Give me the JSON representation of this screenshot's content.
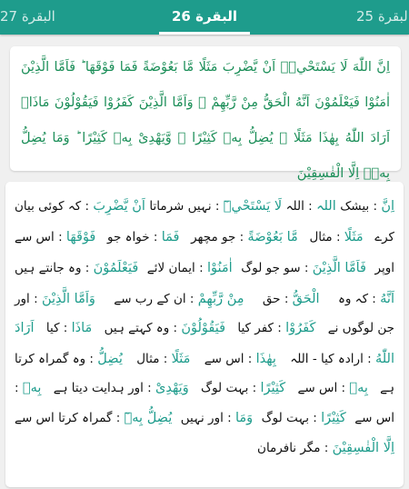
{
  "tabs": {
    "left": "البقرة 27",
    "center": "البقرة 26",
    "right": "البقرة 25"
  },
  "verse": {
    "arabic": "اِنَّ اللّٰهَ لَا يَسْتَحْيٖۤ اَنْ يَّضْرِبَ مَثَلًا مَّا بَعُوْضَةً فَمَا فَوْقَهَا ؕ فَاَمَّا الَّذِيْنَ اٰمَنُوْا فَيَعْلَمُوْنَ اَنَّهُ الْحَقُّ مِنْ رَّبِّهِمْ ۚ وَاَمَّا الَّذِيْنَ كَفَرُوْا فَيَقُوْلُوْنَ مَاذَاۤ اَرَادَ اللّٰهُ بِهٰذَا مَثَلًا ۘ يُضِلُّ بِهٖ كَثِيْرًا ۙ وَّيَهْدِىْ بِهٖ كَثِيْرًا ؕ وَمَا يُضِلُّ بِهٖۤ اِلَّا الْفٰسِقِيْنَ"
  },
  "translation": {
    "line1": [
      "اِنَّ",
      " : بیشک",
      "  اللہ",
      " : اللہ",
      "  لَا يَسْتَحْيٖٓ",
      " : نہیں شرماتا",
      "  اَنْ يَّضْرِبَ",
      " : کہ کوئی بیان"
    ],
    "line2": [
      "کرے",
      "  مَثَلًا",
      " : مثال",
      "  مَّا بَعُوْضَةً",
      " : جو مچھر",
      "  فَمَا",
      " : خواہ جو",
      "  فَوْقَهَا",
      " : اس سے"
    ],
    "line3": [
      "اوپر",
      "  فَاَمَّا الَّذِيْنَ",
      " : سو جو لوگ",
      "  اٰمَنُوْا",
      " : ایمان لائے",
      "  فَيَعْلَمُوْنَ",
      " : وہ جانتے ہیں"
    ],
    "line4": [
      "اَنَّهُ",
      " : کہ وہ",
      "  الْحَقُّ",
      " : حق",
      "  مِنْ رَّبِّهِمْ",
      " : ان کے رب سے",
      "  وَاَمَّا الَّذِيْنَ",
      " : اور"
    ],
    "line5": [
      "جن لوگوں نے",
      "  كَفَرُوْا",
      " : کفر کیا",
      "  فَيَقُوْلُوْنَ",
      " : وہ کہتے ہیں",
      "  مَاذَا",
      " : کیا",
      "  اَرَادَ"
    ],
    "line6": [
      "اللّٰهُ",
      " : ارادہ کیا - اللہ",
      "  بِهٰذَا",
      " : اس سے",
      "  مَثَلًا",
      " : مثال",
      "  يُضِلُّ",
      " : وہ گمراہ کرتا"
    ],
    "line7": [
      "ہے",
      "  بِهٖ",
      " : اس سے",
      "  كَثِيْرًا",
      " : بہت لوگ",
      "  وَيَهْدِىْ",
      " : اور ہدایت دیتا ہے",
      "  بِهٖ",
      " :"
    ],
    "line8": [
      "اس سے",
      "  كَثِيْرًا",
      " : بہت لوگ",
      "  وَمَا",
      " : اور نہیں",
      "  يُضِلُّ بِهٖٓ",
      " : گمراہ کرتا اس سے"
    ],
    "line9": [
      "اِلَّا الْفٰسِقِيْنَ",
      " : مگر نافرمان"
    ]
  }
}
